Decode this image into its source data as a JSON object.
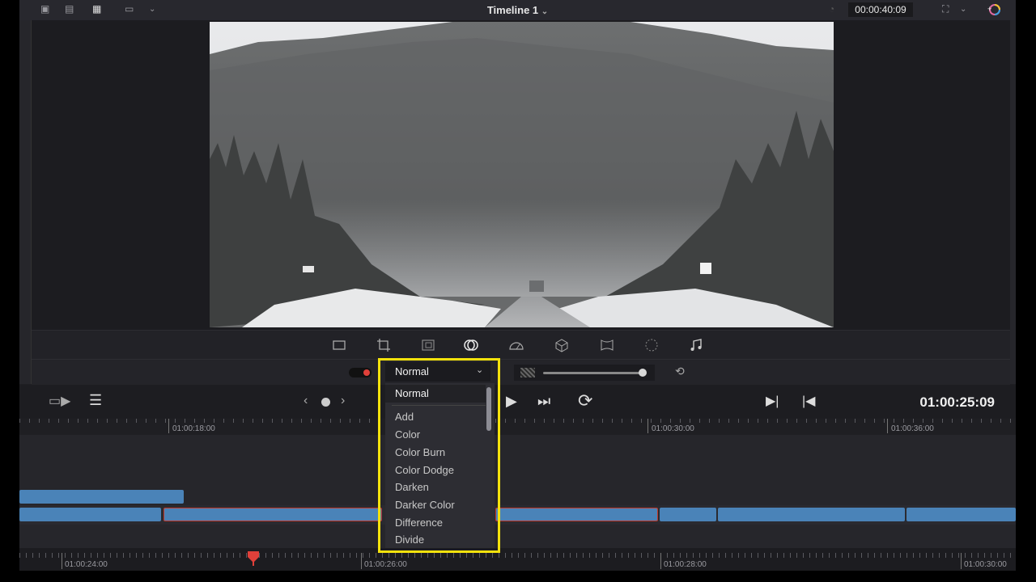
{
  "topbar": {
    "title": "Timeline 1",
    "timecode": "00:00:40:09"
  },
  "viewer": {
    "tools": [
      "transform-icon",
      "crop-icon",
      "dynamic-zoom-icon",
      "composite-icon",
      "speed-icon",
      "stabilization-icon",
      "lens-correction-icon",
      "retime-icon",
      "audio-icon"
    ]
  },
  "composite": {
    "mode_selected": "Normal",
    "dropdown_items": [
      "Normal",
      "Add",
      "Color",
      "Color Burn",
      "Color Dodge",
      "Darken",
      "Darker Color",
      "Difference",
      "Divide"
    ],
    "opacity": 1.0
  },
  "transport": {
    "timecode": "01:00:25:09"
  },
  "timeline": {
    "upper_ruler_labels": [
      "01:00:18:00",
      "01:00:30:00",
      "01:00:36:00"
    ],
    "lower_ruler_labels": [
      "01:00:24:00",
      "01:00:26:00",
      "01:00:28:00",
      "01:00:30:00"
    ]
  },
  "colors": {
    "highlight": "#f4e20c",
    "clip": "#4a83b8",
    "playhead": "#e0403a",
    "selected_clip_border": "#c0392b"
  }
}
